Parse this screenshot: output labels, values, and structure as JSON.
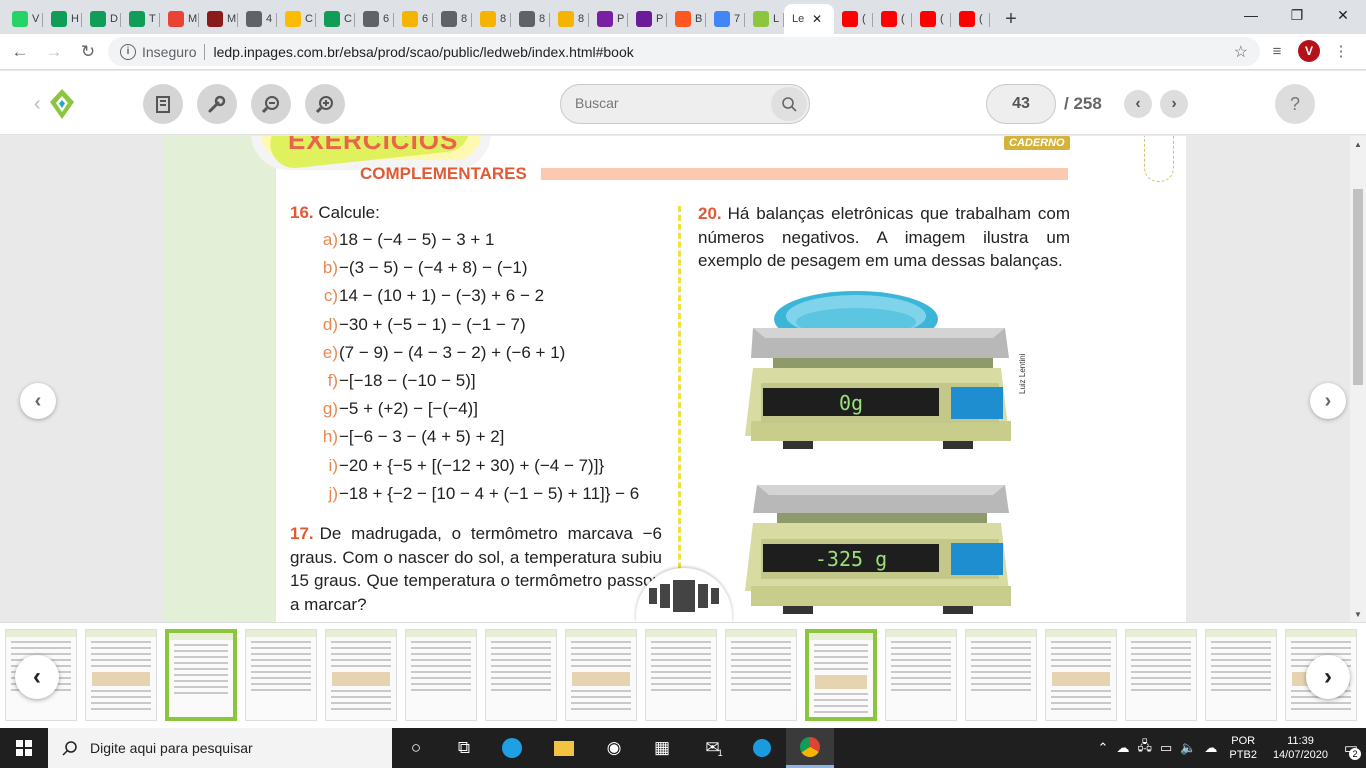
{
  "browser": {
    "tabs": [
      {
        "label": "V",
        "icon": "whatsapp-icon",
        "color": "#25d366"
      },
      {
        "label": "H",
        "icon": "classroom-icon",
        "color": "#0f9d58"
      },
      {
        "label": "D",
        "icon": "classroom-icon",
        "color": "#0f9d58"
      },
      {
        "label": "T",
        "icon": "classroom-icon",
        "color": "#0f9d58"
      },
      {
        "label": "M",
        "icon": "gmail-icon",
        "color": "#ea4335"
      },
      {
        "label": "M",
        "icon": "books-icon",
        "color": "#8b1a1a"
      },
      {
        "label": "4",
        "icon": "globe-icon",
        "color": "#5f6368"
      },
      {
        "label": "C",
        "icon": "drive-icon",
        "color": "#fbbc04"
      },
      {
        "label": "C",
        "icon": "classroom-icon",
        "color": "#0f9d58"
      },
      {
        "label": "6",
        "icon": "globe-icon",
        "color": "#5f6368"
      },
      {
        "label": "6",
        "icon": "slides-icon",
        "color": "#f4b400"
      },
      {
        "label": "8",
        "icon": "globe-icon",
        "color": "#5f6368"
      },
      {
        "label": "8",
        "icon": "slides-icon",
        "color": "#f4b400"
      },
      {
        "label": "8",
        "icon": "globe-icon",
        "color": "#5f6368"
      },
      {
        "label": "8",
        "icon": "slides-icon",
        "color": "#f4b400"
      },
      {
        "label": "P",
        "icon": "purple-circle-icon",
        "color": "#7b1fa2"
      },
      {
        "label": "P",
        "icon": "purple-square-icon",
        "color": "#6a1b9a"
      },
      {
        "label": "B",
        "icon": "blogger-icon",
        "color": "#ff5722"
      },
      {
        "label": "7",
        "icon": "docs-icon",
        "color": "#4285f4"
      },
      {
        "label": "L",
        "icon": "ledp-icon",
        "color": "#8cc63e"
      },
      {
        "label": "Le",
        "icon": "none",
        "color": "#ffffff",
        "active": true
      },
      {
        "label": "(",
        "icon": "youtube-icon",
        "color": "#ff0000"
      },
      {
        "label": "(",
        "icon": "youtube-icon",
        "color": "#ff0000"
      },
      {
        "label": "(",
        "icon": "youtube-icon",
        "color": "#ff0000"
      },
      {
        "label": "(",
        "icon": "youtube-icon",
        "color": "#ff0000"
      }
    ],
    "new_tab": "+",
    "insecure_label": "Inseguro",
    "url": "ledp.inpages.com.br/ebsa/prod/scao/public/ledweb/index.html#book",
    "avatar_letter": "V"
  },
  "reader": {
    "search_placeholder": "Buscar",
    "current_page": "43",
    "total_pages": "/ 258",
    "help": "?"
  },
  "page": {
    "section_title": "EXERCÍCIOS",
    "section_subtitle": "COMPLEMENTARES",
    "badge": "CADERNO",
    "q16": {
      "number": "16.",
      "title": "Calcule:",
      "items": [
        {
          "letter": "a)",
          "expr": "18 − (−4 −  5) − 3 + 1"
        },
        {
          "letter": "b)",
          "expr": "−(3 − 5) − (−4 + 8) − (−1)"
        },
        {
          "letter": "c)",
          "expr": "14 − (10 + 1) − (−3) + 6 − 2"
        },
        {
          "letter": "d)",
          "expr": "−30 + (−5 − 1) − (−1 − 7)"
        },
        {
          "letter": "e)",
          "expr": "(7 − 9) − (4 − 3 − 2) + (−6 + 1)"
        },
        {
          "letter": "f)",
          "expr": "−[−18 − (−10 − 5)]"
        },
        {
          "letter": "g)",
          "expr": "−5 + (+2) − [−(−4)]"
        },
        {
          "letter": "h)",
          "expr": "−[−6 − 3 − (4 + 5) + 2]"
        },
        {
          "letter": "i)",
          "expr": "−20 + {−5 + [(−12 + 30) + (−4 − 7)]}"
        },
        {
          "letter": "j)",
          "expr": "−18 + {−2 − [10 − 4 + (−1 − 5) + 11]} − 6"
        }
      ]
    },
    "q17": {
      "number": "17.",
      "text": "De madrugada, o termômetro marcava −6 graus. Com o nascer do sol, a temperatura subiu 15 graus. Que temperatura o termômetro passou a marcar?"
    },
    "q20": {
      "number": "20.",
      "text": "Há balanças eletrônicas que trabalham com números negativos. A imagem ilustra um exemplo de pesagem em uma dessas balanças."
    },
    "scale1_display": "0g",
    "scale2_display": "-325 g",
    "credit": "Luiz Lentini"
  },
  "thumbnails_count": 17,
  "taskbar": {
    "search_placeholder": "Digite aqui para pesquisar",
    "mail_badge": "1",
    "lang_top": "POR",
    "lang_bottom": "PTB2",
    "time": "11:39",
    "date": "14/07/2020",
    "notif_count": "2"
  },
  "colors": {
    "accent_green": "#8cc63e",
    "orange": "#e15a36"
  }
}
